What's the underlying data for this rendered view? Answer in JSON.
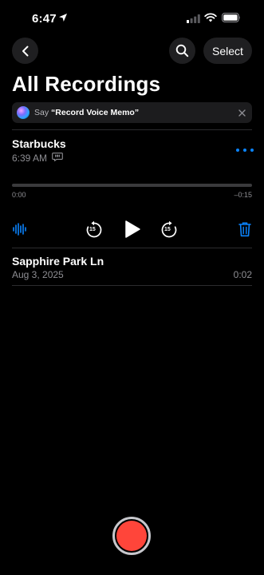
{
  "status_bar": {
    "time": "6:47"
  },
  "nav": {
    "select_label": "Select"
  },
  "page": {
    "title": "All Recordings"
  },
  "siri_banner": {
    "prefix": "Say",
    "phrase": "“Record Voice Memo”"
  },
  "recordings": [
    {
      "name": "Starbucks",
      "time": "6:39 AM",
      "elapsed": "0:00",
      "remaining": "–0:15",
      "skip_back": "15",
      "skip_forward": "15",
      "playback_progress": 0
    },
    {
      "name": "Sapphire Park Ln",
      "date": "Aug 3, 2025",
      "duration": "0:02"
    }
  ],
  "colors": {
    "accent": "#0a84ff",
    "record": "#ff453a",
    "background": "#000000"
  },
  "icons": [
    "location-arrow-icon",
    "signal-icon",
    "wifi-icon",
    "battery-icon",
    "chevron-left-icon",
    "search-icon",
    "siri-icon",
    "close-icon",
    "transcript-icon",
    "more-icon",
    "waveform-icon",
    "skip-back-icon",
    "play-icon",
    "skip-forward-icon",
    "trash-icon",
    "record-icon"
  ]
}
